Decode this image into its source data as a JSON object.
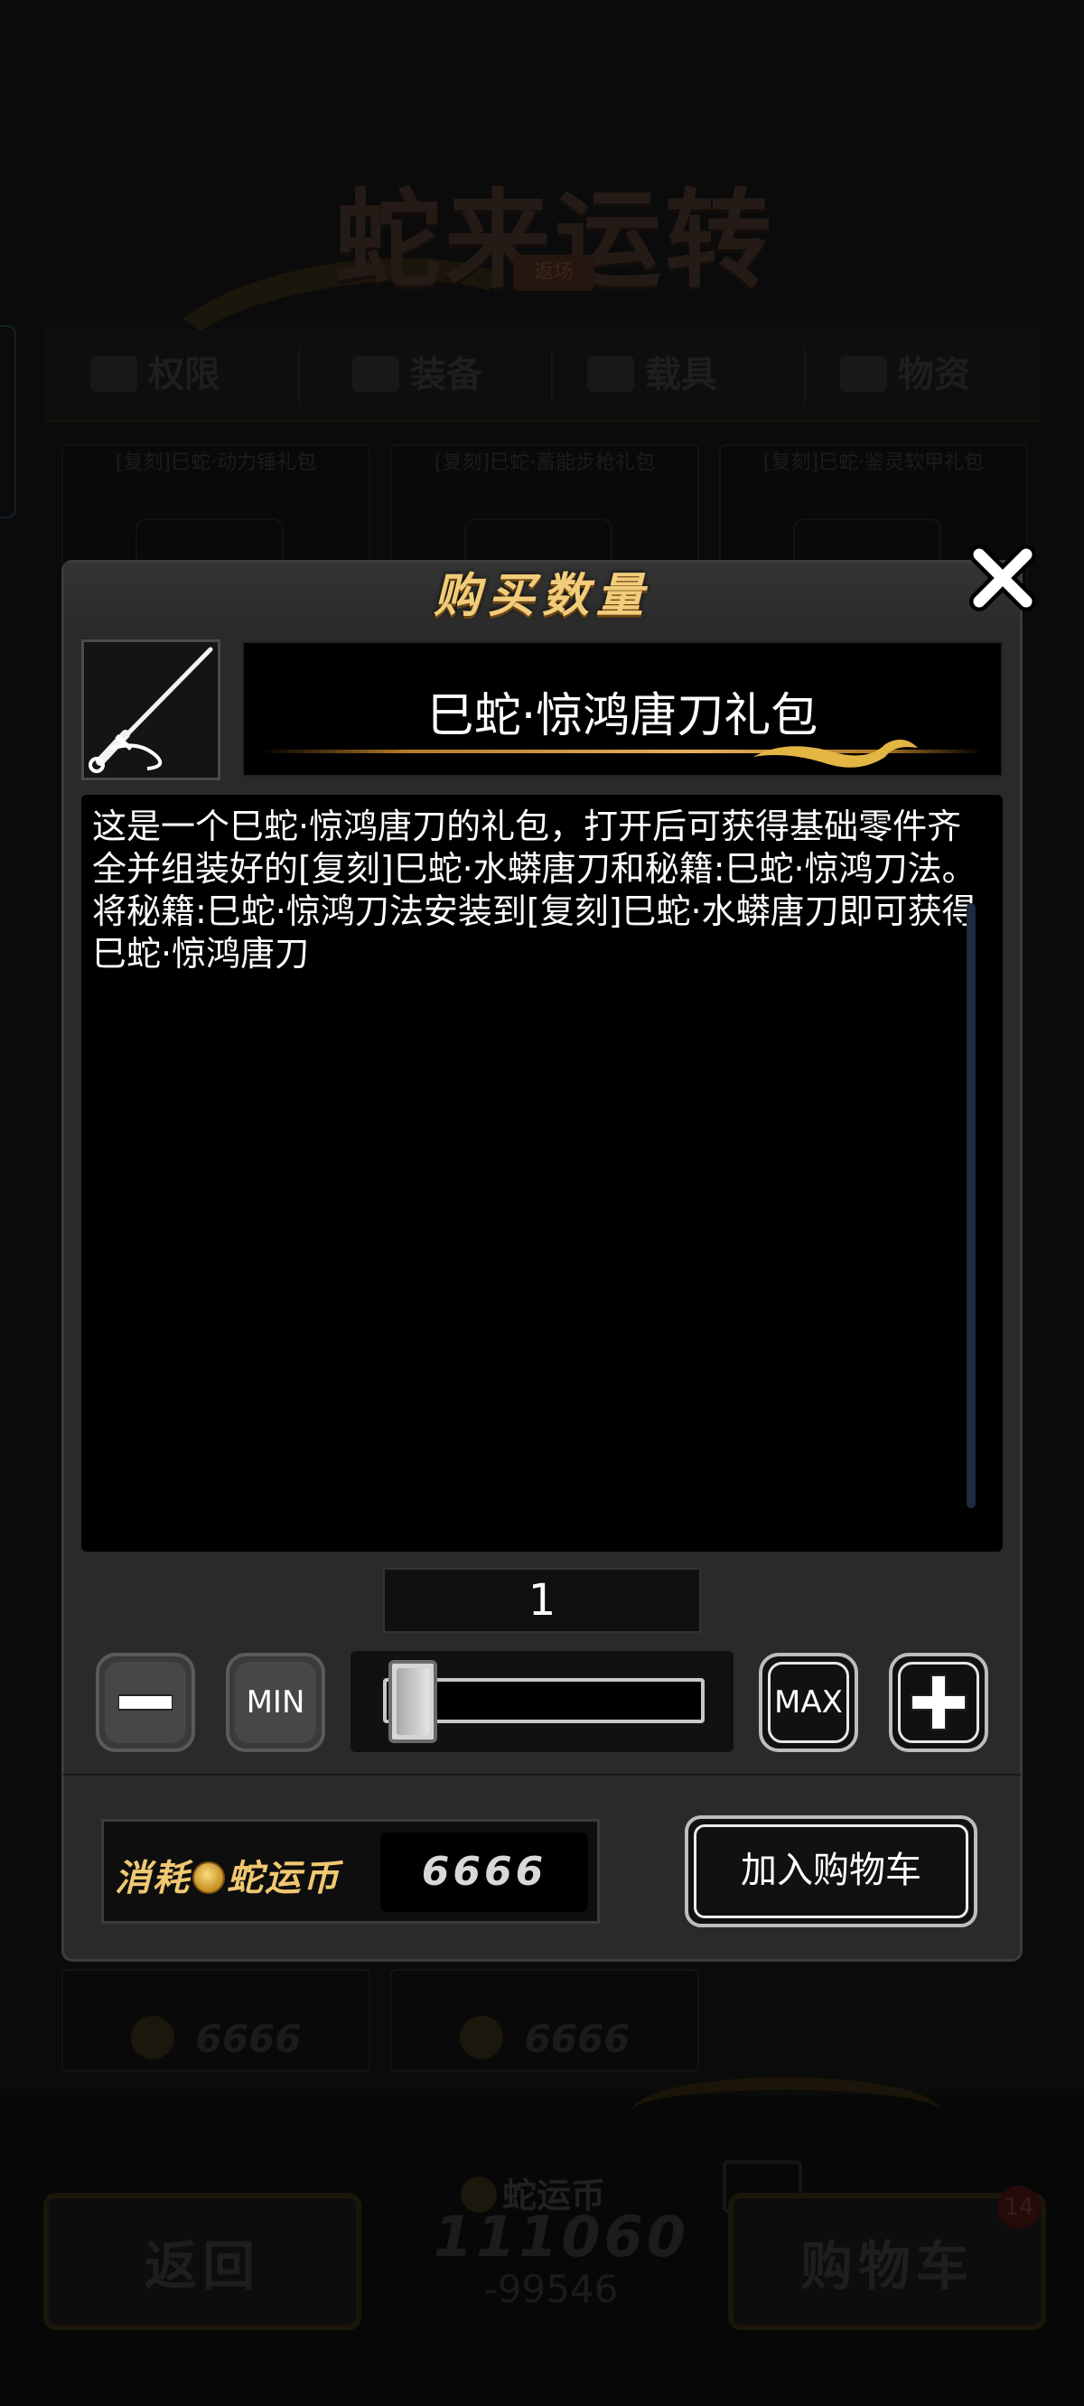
{
  "background": {
    "logo_title": "蛇来运转",
    "logo_subtitle": "返场",
    "categories": [
      {
        "label": "权限"
      },
      {
        "label": "装备"
      },
      {
        "label": "载具"
      },
      {
        "label": "物资"
      }
    ],
    "cards_top": [
      {
        "name": "[复刻]巳蛇·动力锤礼包"
      },
      {
        "name": "[复刻]巳蛇·蓄能步枪礼包"
      },
      {
        "name": "[复刻]巳蛇·鉴灵软甲礼包"
      }
    ],
    "cards_bottom": [
      {
        "price": "6666"
      },
      {
        "price": "6666"
      }
    ],
    "back_button": "返回",
    "currency_label": "蛇运币",
    "currency_balance": "111060",
    "currency_delta": "-99546",
    "cart_button": "购物车",
    "cart_badge": "14"
  },
  "modal": {
    "title": "购买数量",
    "item_name": "巳蛇·惊鸿唐刀礼包",
    "description": "这是一个巳蛇·惊鸿唐刀的礼包，打开后可获得基础零件齐全并组装好的[复刻]巳蛇·水蟒唐刀和秘籍:巳蛇·惊鸿刀法。\n将秘籍:巳蛇·惊鸿刀法安装到[复刻]巳蛇·水蟒唐刀即可获得巳蛇·惊鸿唐刀",
    "quantity": "1",
    "min_label": "MIN",
    "max_label": "MAX",
    "slider_fraction": 0.0,
    "cost_label_prefix": "消耗",
    "cost_label_currency": "蛇运币",
    "cost_value": "6666",
    "add_to_cart_label": "加入购物车"
  },
  "colors": {
    "title_gold": "#f1cc7a",
    "panel": "#2a2a2a",
    "desc_bg": "#000000"
  },
  "icons": [
    "close-icon",
    "minus-icon",
    "plus-icon",
    "katana-icon",
    "coin-icon"
  ]
}
